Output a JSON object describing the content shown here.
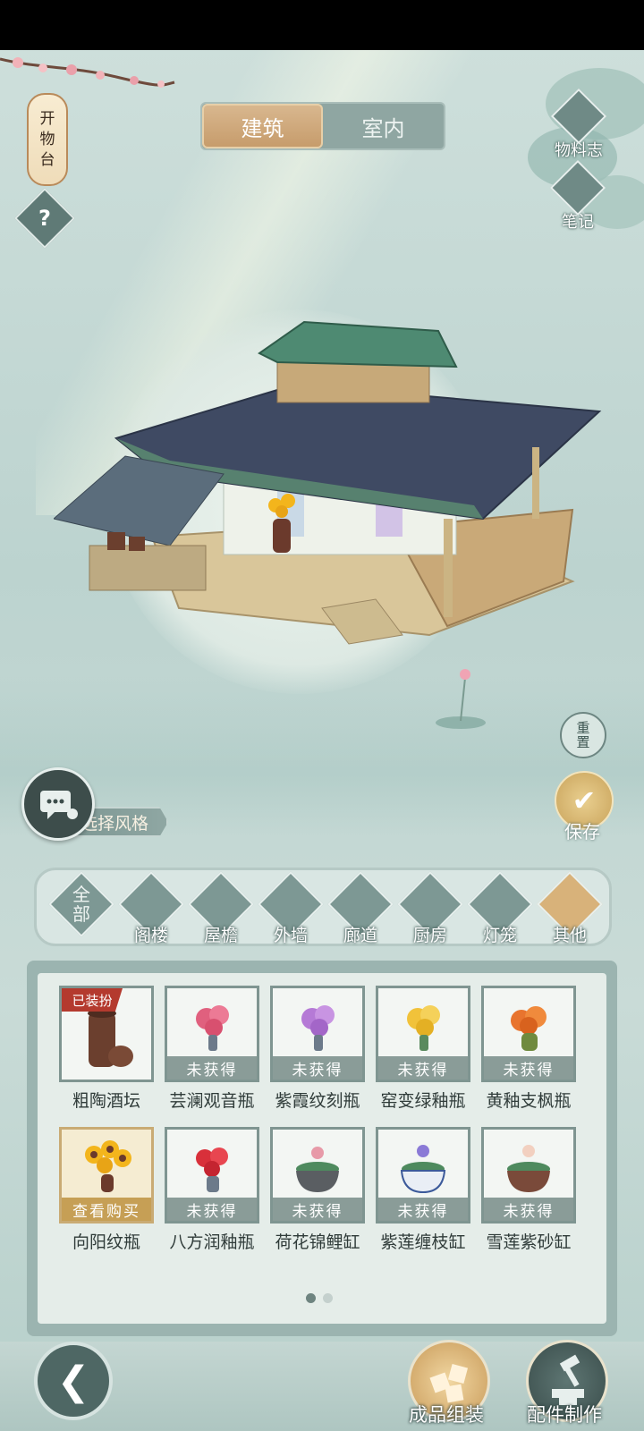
{
  "top_tabs": [
    {
      "label": "建筑",
      "active": true
    },
    {
      "label": "室内",
      "active": false
    }
  ],
  "lantern": {
    "lines": [
      "开",
      "物",
      "台"
    ]
  },
  "help": {
    "symbol": "?"
  },
  "side_buttons": {
    "materials": "物料志",
    "notes": "笔记"
  },
  "reset": {
    "label": "重置",
    "lines": [
      "重",
      "置"
    ]
  },
  "save": {
    "label": "保存"
  },
  "style_selector": {
    "label": "选择风格"
  },
  "categories": [
    {
      "label": "全部",
      "lines": [
        "全",
        "部"
      ],
      "icon": "all-icon",
      "active": false
    },
    {
      "label": "阁楼",
      "icon": "pavilion-icon",
      "active": false
    },
    {
      "label": "屋檐",
      "icon": "eave-icon",
      "active": false
    },
    {
      "label": "外墙",
      "icon": "wall-icon",
      "active": false
    },
    {
      "label": "廊道",
      "icon": "corridor-icon",
      "active": false
    },
    {
      "label": "厨房",
      "icon": "kitchen-icon",
      "active": false
    },
    {
      "label": "灯笼",
      "icon": "lantern-icon",
      "active": false
    },
    {
      "label": "其他",
      "icon": "other-icon",
      "active": true
    }
  ],
  "items": [
    {
      "name": "粗陶酒坛",
      "status": "",
      "tag": "已装扮",
      "color": "#6b3f2e"
    },
    {
      "name": "芸澜观音瓶",
      "status": "未获得",
      "tag": "",
      "color": "#e0607e"
    },
    {
      "name": "紫霞纹刻瓶",
      "status": "未获得",
      "tag": "",
      "color": "#b57ad6"
    },
    {
      "name": "窑变绿釉瓶",
      "status": "未获得",
      "tag": "",
      "color": "#f1c23a"
    },
    {
      "name": "黄釉支枫瓶",
      "status": "未获得",
      "tag": "",
      "color": "#e8742e"
    },
    {
      "name": "向阳纹瓶",
      "status": "查看购买",
      "tag": "",
      "color": "#f3b51c"
    },
    {
      "name": "八方润釉瓶",
      "status": "未获得",
      "tag": "",
      "color": "#d8303a"
    },
    {
      "name": "荷花锦鲤缸",
      "status": "未获得",
      "tag": "",
      "color": "#e79aa8"
    },
    {
      "name": "紫莲缠枝缸",
      "status": "未获得",
      "tag": "",
      "color": "#8a7ad6"
    },
    {
      "name": "雪莲紫砂缸",
      "status": "未获得",
      "tag": "",
      "color": "#f2d0c0"
    }
  ],
  "pagination": {
    "pages": 2,
    "current": 1
  },
  "bottom": {
    "assemble": "成品组装",
    "craft": "配件制作"
  }
}
